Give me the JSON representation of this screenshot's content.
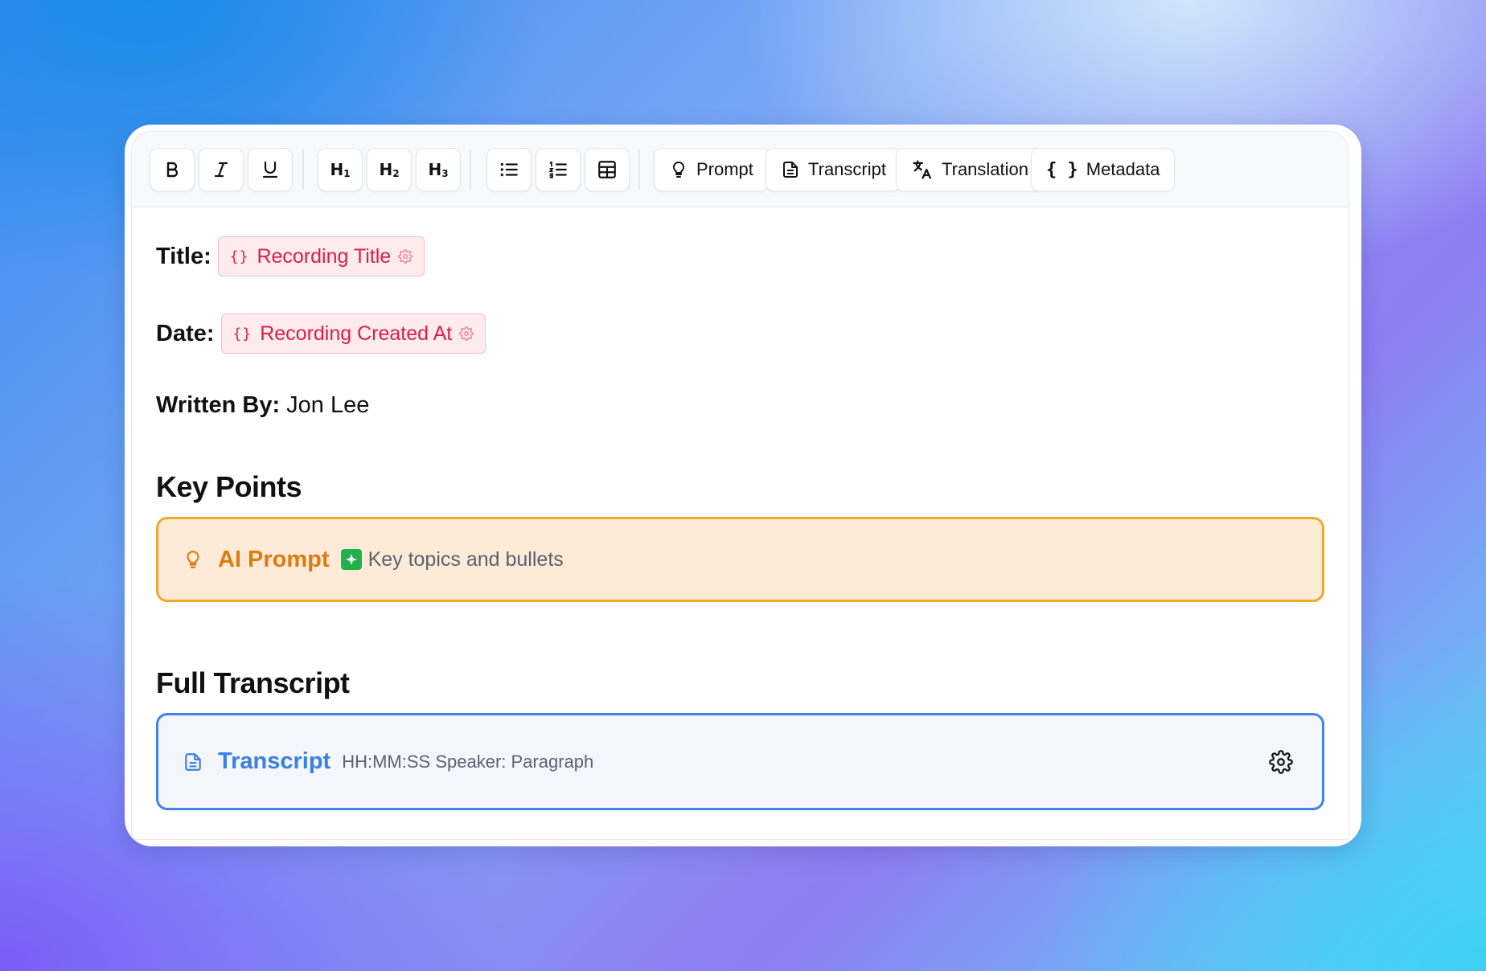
{
  "toolbar": {
    "prompt_label": "Prompt",
    "transcript_label": "Transcript",
    "translation_label": "Translation",
    "metadata_label": "Metadata",
    "h1_label": "H",
    "h1_sub": "1",
    "h2_label": "H",
    "h2_sub": "2",
    "h3_label": "H",
    "h3_sub": "3",
    "metadata_icon": "{ }"
  },
  "fields": {
    "title_label": "Title:",
    "title_variable": "Recording Title",
    "date_label": "Date:",
    "date_variable": "Recording Created At",
    "variable_icon": "{}",
    "written_by_label": "Written By:",
    "written_by_value": "Jon Lee"
  },
  "sections": {
    "key_points_heading": "Key Points",
    "full_transcript_heading": "Full Transcript"
  },
  "prompt_block": {
    "title": "AI Prompt",
    "description": "Key topics and bullets"
  },
  "transcript_block": {
    "title": "Transcript",
    "format": "HH:MM:SS Speaker: Paragraph"
  },
  "colors": {
    "variable_accent": "#dc1f45",
    "prompt_accent": "#f3a729",
    "transcript_accent": "#3f83e8"
  }
}
